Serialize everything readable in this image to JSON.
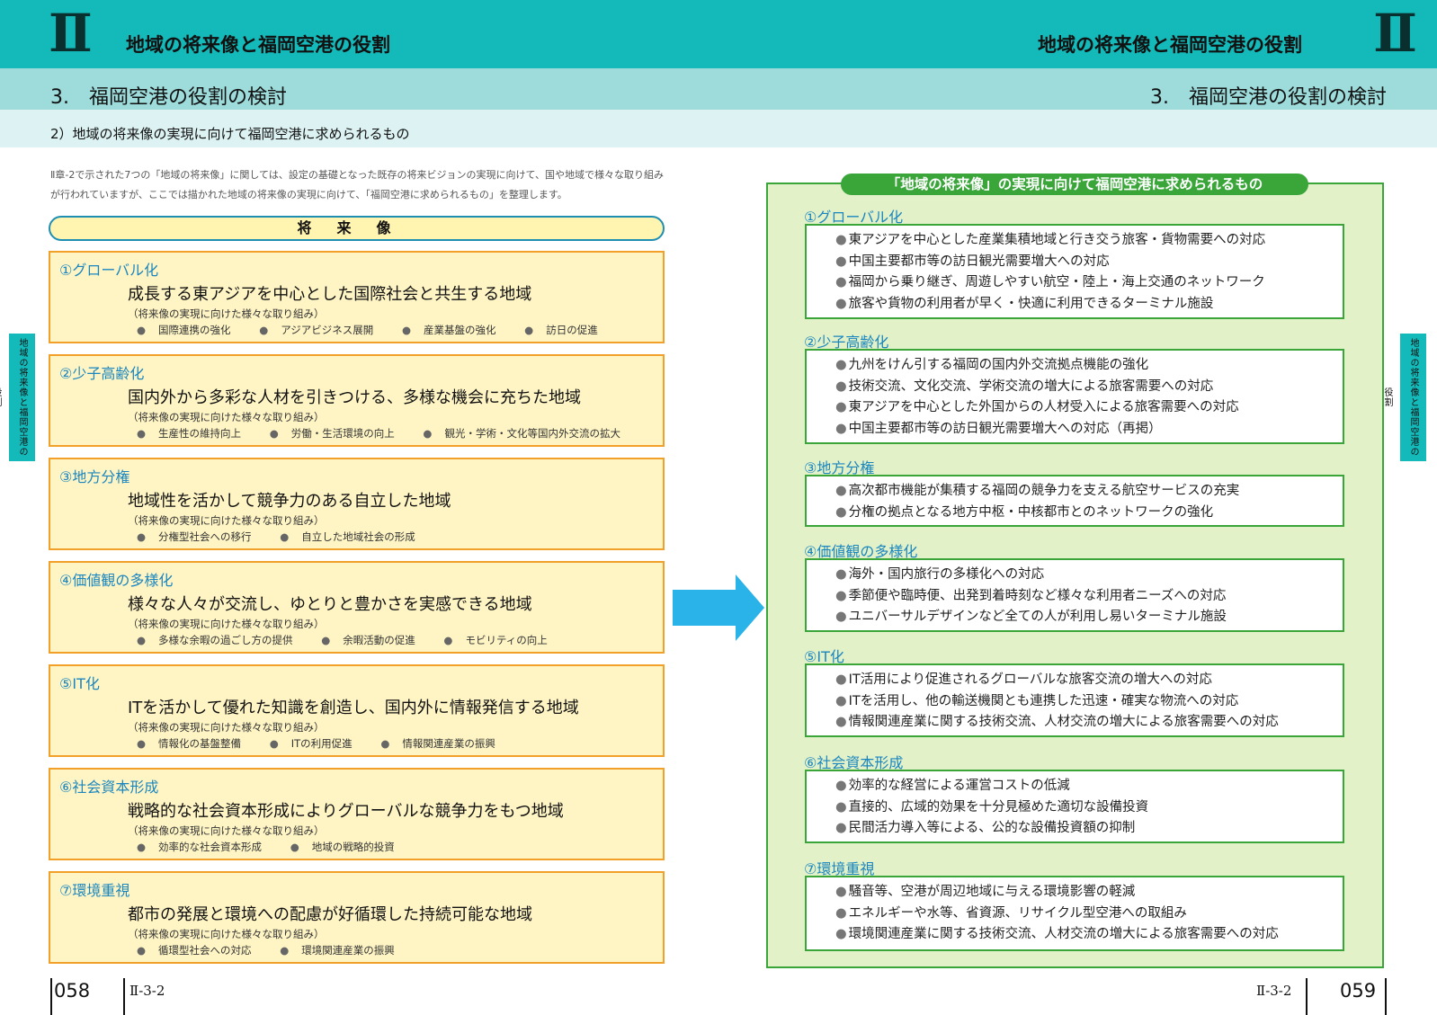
{
  "header": {
    "roman": "Ⅱ",
    "chapter_title": "地域の将来像と福岡空港の役割",
    "section_title": "3.　福岡空港の役割の検討",
    "subsection_title": "2）地域の将来像の実現に向けて福岡空港に求められるもの"
  },
  "intro": "Ⅱ章-2で示された7つの「地域の将来像」に関しては、設定の基礎となった既存の将来ビジョンの実現に向けて、国や地域で様々な取り組みが行われていますが、ここでは描かれた地域の将来像の実現に向けて、「福岡空港に求められるもの」を整理します。",
  "side_tab": "地域の将来像と福岡空港の役割",
  "left": {
    "header_label": "将来像",
    "visions": [
      {
        "num": "①グローバル化",
        "main": "成長する東アジアを中心とした国際社会と共生する地域",
        "note": "（将来像の実現に向けた様々な取り組み）",
        "items": [
          "国際連携の強化",
          "アジアビジネス展開",
          "産業基盤の強化",
          "訪日の促進"
        ]
      },
      {
        "num": "②少子高齢化",
        "main": "国内外から多彩な人材を引きつける、多様な機会に充ちた地域",
        "note": "（将来像の実現に向けた様々な取り組み）",
        "items": [
          "生産性の維持向上",
          "労働・生活環境の向上",
          "観光・学術・文化等国内外交流の拡大"
        ]
      },
      {
        "num": "③地方分権",
        "main": "地域性を活かして競争力のある自立した地域",
        "note": "（将来像の実現に向けた様々な取り組み）",
        "items": [
          "分権型社会への移行",
          "自立した地域社会の形成"
        ]
      },
      {
        "num": "④価値観の多様化",
        "main": "様々な人々が交流し、ゆとりと豊かさを実感できる地域",
        "note": "（将来像の実現に向けた様々な取り組み）",
        "items": [
          "多様な余暇の過ごし方の提供",
          "余暇活動の促進",
          "モビリティの向上"
        ]
      },
      {
        "num": "⑤IT化",
        "main": "ITを活かして優れた知識を創造し、国内外に情報発信する地域",
        "note": "（将来像の実現に向けた様々な取り組み）",
        "items": [
          "情報化の基盤整備",
          "ITの利用促進",
          "情報関連産業の振興"
        ]
      },
      {
        "num": "⑥社会資本形成",
        "main": "戦略的な社会資本形成によりグローバルな競争力をもつ地域",
        "note": "（将来像の実現に向けた様々な取り組み）",
        "items": [
          "効率的な社会資本形成",
          "地域の戦略的投資"
        ]
      },
      {
        "num": "⑦環境重視",
        "main": "都市の発展と環境への配慮が好循環した持続可能な地域",
        "note": "（将来像の実現に向けた様々な取り組み）",
        "items": [
          "循環型社会への対応",
          "環境関連産業の振興"
        ]
      }
    ]
  },
  "right": {
    "panel_title": "「地域の将来像」の実現に向けて福岡空港に求められるもの",
    "requirements": [
      {
        "num": "①グローバル化",
        "items": [
          "東アジアを中心とした産業集積地域と行き交う旅客・貨物需要への対応",
          "中国主要都市等の訪日観光需要増大への対応",
          "福岡から乗り継ぎ、周遊しやすい航空・陸上・海上交通のネットワーク",
          "旅客や貨物の利用者が早く・快適に利用できるターミナル施設"
        ]
      },
      {
        "num": "②少子高齢化",
        "items": [
          "九州をけん引する福岡の国内外交流拠点機能の強化",
          "技術交流、文化交流、学術交流の増大による旅客需要への対応",
          "東アジアを中心とした外国からの人材受入による旅客需要への対応",
          "中国主要都市等の訪日観光需要増大への対応（再掲）"
        ]
      },
      {
        "num": "③地方分権",
        "items": [
          "高次都市機能が集積する福岡の競争力を支える航空サービスの充実",
          "分権の拠点となる地方中枢・中核都市とのネットワークの強化"
        ]
      },
      {
        "num": "④価値観の多様化",
        "items": [
          "海外・国内旅行の多様化への対応",
          "季節便や臨時便、出発到着時刻など様々な利用者ニーズへの対応",
          "ユニバーサルデザインなど全ての人が利用し易いターミナル施設"
        ]
      },
      {
        "num": "⑤IT化",
        "items": [
          "IT活用により促進されるグローバルな旅客交流の増大への対応",
          "ITを活用し、他の輸送機関とも連携した迅速・確実な物流への対応",
          "情報関連産業に関する技術交流、人材交流の増大による旅客需要への対応"
        ]
      },
      {
        "num": "⑥社会資本形成",
        "items": [
          "効率的な経営による運営コストの低減",
          "直接的、広域的効果を十分見極めた適切な設備投資",
          "民間活力導入等による、公的な設備投資額の抑制"
        ]
      },
      {
        "num": "⑦環境重視",
        "items": [
          "騒音等、空港が周辺地域に与える環境影響の軽減",
          "エネルギーや水等、省資源、リサイクル型空港への取組み",
          "環境関連産業に関する技術交流、人材交流の増大による旅客需要への対応"
        ]
      }
    ]
  },
  "footer": {
    "left_page": "058",
    "left_ref": "Ⅱ-3-2",
    "right_page": "059",
    "right_ref": "Ⅱ-3-2"
  }
}
